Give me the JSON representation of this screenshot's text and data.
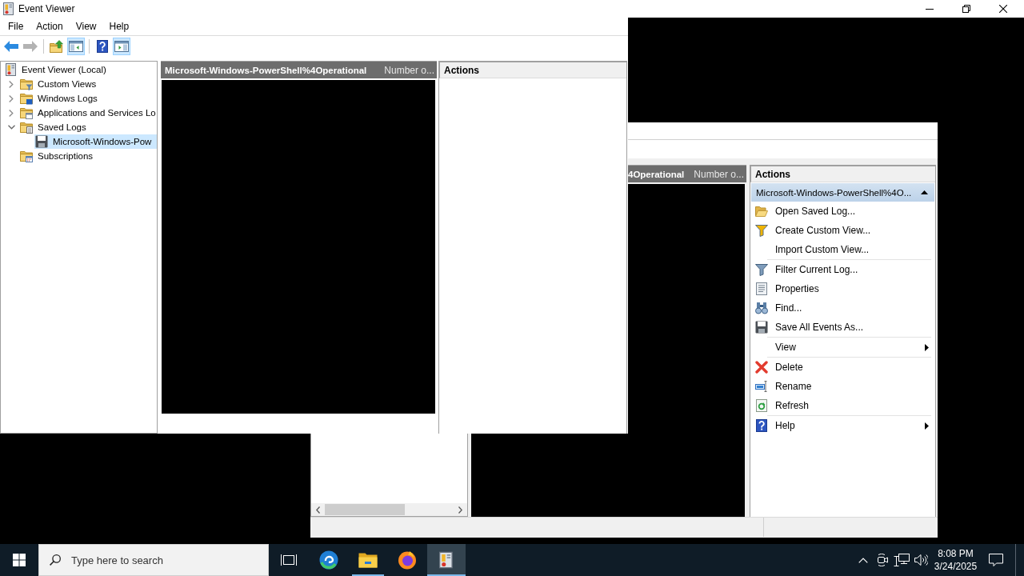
{
  "title_bar": {
    "title": "Event Viewer"
  },
  "menu": [
    "File",
    "Action",
    "View",
    "Help"
  ],
  "toolbar": [
    [
      {
        "kind": "back",
        "disabled": false,
        "pressed": false
      },
      {
        "kind": "forward",
        "disabled": true,
        "pressed": false
      }
    ],
    [
      {
        "kind": "up",
        "disabled": false,
        "pressed": false
      },
      {
        "kind": "tree",
        "disabled": false,
        "pressed": true
      }
    ],
    [
      {
        "kind": "help",
        "disabled": false,
        "pressed": false
      },
      {
        "kind": "pane",
        "disabled": false,
        "pressed": true
      }
    ]
  ],
  "tree": [
    {
      "label": "Event Viewer (Local)",
      "kind": "root",
      "selected": false,
      "children": [
        {
          "label": "Custom Views",
          "kind": "views",
          "expanded": false,
          "selected": false
        },
        {
          "label": "Windows Logs",
          "kind": "logs",
          "expanded": false,
          "selected": false
        },
        {
          "label": "Applications and Services Lo",
          "kind": "services",
          "expanded": false,
          "selected": false
        },
        {
          "label": "Saved Logs",
          "kind": "saved",
          "expanded": true,
          "selected": false,
          "children": [
            {
              "label": "Microsoft-Windows-Pow",
              "kind": "file",
              "selected": true
            }
          ]
        },
        {
          "label": "Subscriptions",
          "kind": "subscriptions",
          "selected": false
        }
      ]
    }
  ],
  "log_pane": {
    "title": "Microsoft-Windows-PowerShell%4Operational",
    "column_2": "Number o..."
  },
  "actions_pane": {
    "title": "Actions"
  },
  "back_window": {
    "log_pane": {
      "title": "4Operational",
      "column_2": "Number o..."
    },
    "actions_pane": {
      "title": "Actions",
      "section": {
        "title": "Microsoft-Windows-PowerShell%4O...",
        "expanded": true
      },
      "groups": [
        [
          {
            "label": "Open Saved Log...",
            "kind": "open",
            "submenu": false
          },
          {
            "label": "Create Custom View...",
            "kind": "create",
            "submenu": false
          },
          {
            "label": "Import Custom View...",
            "kind": "import",
            "submenu": false
          }
        ],
        [
          {
            "label": "Filter Current Log...",
            "kind": "filter",
            "submenu": false
          },
          {
            "label": "Properties",
            "kind": "properties",
            "submenu": false
          },
          {
            "label": "Find...",
            "kind": "find",
            "submenu": false
          },
          {
            "label": "Save All Events As...",
            "kind": "save",
            "submenu": false
          }
        ],
        [
          {
            "label": "View",
            "kind": "view",
            "submenu": true
          }
        ],
        [
          {
            "label": "Delete",
            "kind": "delete",
            "submenu": false
          },
          {
            "label": "Rename",
            "kind": "rename",
            "submenu": false
          },
          {
            "label": "Refresh",
            "kind": "refresh",
            "submenu": false
          }
        ],
        [
          {
            "label": "Help",
            "kind": "help",
            "submenu": true
          }
        ]
      ]
    }
  },
  "taskbar": {
    "search": {
      "placeholder": "Type here to search"
    },
    "apps": [
      {
        "kind": "browser",
        "running": false,
        "active": false
      },
      {
        "kind": "files",
        "running": true,
        "active": false
      },
      {
        "kind": "fox",
        "running": false,
        "active": false
      },
      {
        "kind": "viewer",
        "running": true,
        "active": true
      }
    ],
    "clock": {
      "time": "8:08 PM",
      "date": "3/24/2025"
    }
  }
}
